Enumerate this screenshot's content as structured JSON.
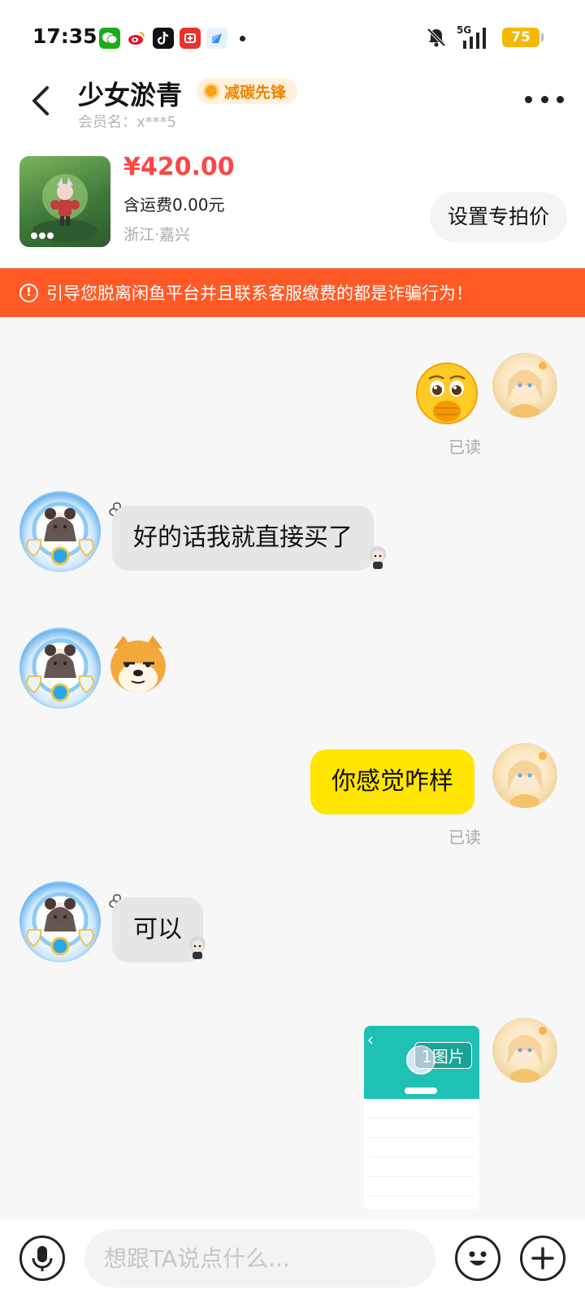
{
  "status_bar": {
    "time": "17:35",
    "network": "5G",
    "battery": "75",
    "app_icons": [
      "wechat-icon",
      "weibo-icon",
      "tiktok-icon",
      "taobao-icon",
      "browser-icon"
    ]
  },
  "header": {
    "seller_name": "少女淤青",
    "badge": "减碳先锋",
    "member_name": "会员名：x***5"
  },
  "product": {
    "price": "¥420.00",
    "shipping": "含运费0.00元",
    "location": "浙江·嘉兴",
    "set_price_button": "设置专拍价"
  },
  "warning": {
    "text": "引导您脱离闲鱼平台并且联系客服缴费的都是诈骗行为！"
  },
  "messages": [
    {
      "sender": "me",
      "type": "sticker",
      "sticker": "shy-face-emoji",
      "status": "已读"
    },
    {
      "sender": "them",
      "type": "text",
      "text": "好的话我就直接买了"
    },
    {
      "sender": "them",
      "type": "sticker",
      "sticker": "doge-emoji"
    },
    {
      "sender": "me",
      "type": "text",
      "text": "你感觉咋样",
      "status": "已读"
    },
    {
      "sender": "them",
      "type": "text",
      "text": "可以"
    },
    {
      "sender": "me",
      "type": "image",
      "label": "1图片"
    }
  ],
  "input": {
    "placeholder": "想跟TA说点什么..."
  },
  "colors": {
    "accent_yellow": "#ffe500",
    "warning_orange": "#ff5a26",
    "price_red": "#ff4646",
    "badge_orange": "#f08400"
  }
}
